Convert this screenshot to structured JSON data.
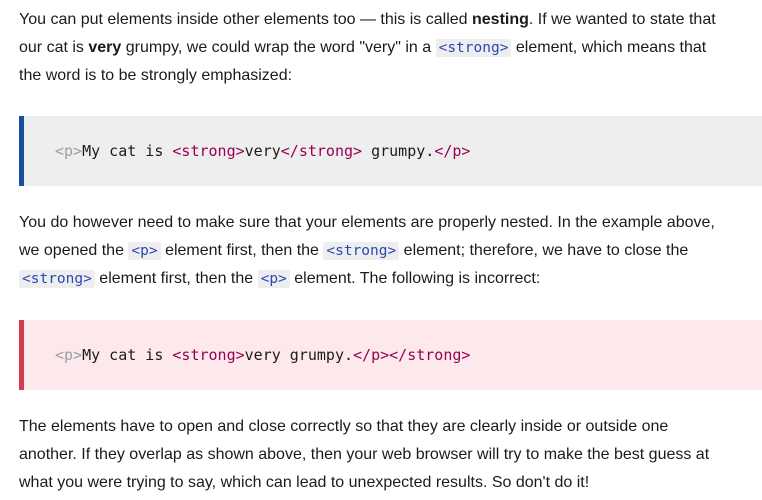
{
  "paragraph1": {
    "t1": "You can put elements inside other elements too — this is called ",
    "bold1": "nesting",
    "t2": ". If we wanted to state that our cat is ",
    "bold2": "very",
    "t3": " grumpy, we could wrap the word \"very\" in a ",
    "code1": "<strong>",
    "t4": " element, which means that the word is to be strongly emphasized:"
  },
  "code_example_correct": {
    "open_p": "<p>",
    "text1": "My cat is ",
    "open_strong": "<strong>",
    "text2": "very",
    "close_strong": "</strong>",
    "text3": " grumpy.",
    "close_p": "</p>"
  },
  "paragraph2": {
    "t1": "You do however need to make sure that your elements are properly nested. In the example above, we opened the ",
    "code1": "<p>",
    "t2": " element first, then the ",
    "code2": "<strong>",
    "t3": " element; therefore, we have to close the ",
    "code3": "<strong>",
    "t4": " element first, then the ",
    "code4": "<p>",
    "t5": " element. The following is incorrect:"
  },
  "code_example_incorrect": {
    "open_p": "<p>",
    "text1": "My cat is ",
    "open_strong": "<strong>",
    "text2": "very grumpy.",
    "close_p": "</p>",
    "close_strong": "</strong>"
  },
  "paragraph3": {
    "text": "The elements have to open and close correctly so that they are clearly inside or outside one another. If they overlap as shown above, then your web browser will try to make the best guess at what you were trying to say, which can lead to unexpected results. So don't do it!"
  },
  "colors": {
    "correct_border": "#1b4da0",
    "correct_bg": "#eeeeee",
    "incorrect_border": "#d43c4e",
    "incorrect_bg": "#fde9ec",
    "tag_color": "#990055",
    "inline_code_color": "#2a47b8"
  }
}
